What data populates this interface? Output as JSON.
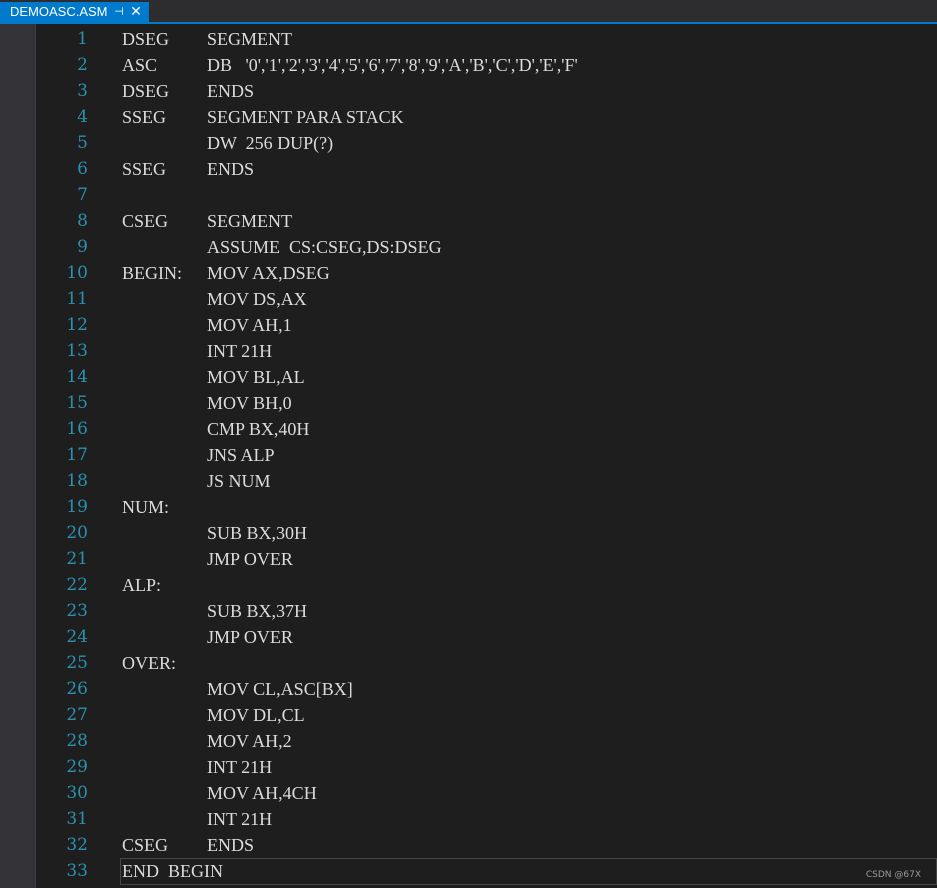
{
  "tab": {
    "filename": "DEMOASC.ASM",
    "pin_icon": "pin-icon",
    "close_icon": "close-icon"
  },
  "colors": {
    "accent": "#007acc",
    "editor_bg": "#1e1e1e",
    "line_number": "#2b91af",
    "text": "#dcdcdc"
  },
  "lines": [
    {
      "n": "1",
      "label": "DSEG",
      "op": "SEGMENT"
    },
    {
      "n": "2",
      "label": "ASC",
      "op": "DB   '0','1','2','3','4','5','6','7','8','9','A','B','C','D','E','F'"
    },
    {
      "n": "3",
      "label": "DSEG",
      "op": "ENDS"
    },
    {
      "n": "4",
      "label": "SSEG",
      "op": "SEGMENT PARA STACK"
    },
    {
      "n": "5",
      "label": "",
      "op": "DW  256 DUP(?)"
    },
    {
      "n": "6",
      "label": "SSEG",
      "op": "ENDS"
    },
    {
      "n": "7",
      "label": "",
      "op": ""
    },
    {
      "n": "8",
      "label": "CSEG",
      "op": "SEGMENT"
    },
    {
      "n": "9",
      "label": "",
      "op": "ASSUME  CS:CSEG,DS:DSEG"
    },
    {
      "n": "10",
      "label": "BEGIN:",
      "op": "MOV AX,DSEG"
    },
    {
      "n": "11",
      "label": "",
      "op": "MOV DS,AX"
    },
    {
      "n": "12",
      "label": "",
      "op": "MOV AH,1"
    },
    {
      "n": "13",
      "label": "",
      "op": "INT 21H"
    },
    {
      "n": "14",
      "label": "",
      "op": "MOV BL,AL"
    },
    {
      "n": "15",
      "label": "",
      "op": "MOV BH,0"
    },
    {
      "n": "16",
      "label": "",
      "op": "CMP BX,40H"
    },
    {
      "n": "17",
      "label": "",
      "op": "JNS ALP"
    },
    {
      "n": "18",
      "label": "",
      "op": "JS NUM"
    },
    {
      "n": "19",
      "label": "NUM:",
      "op": ""
    },
    {
      "n": "20",
      "label": "",
      "op": "SUB BX,30H"
    },
    {
      "n": "21",
      "label": "",
      "op": "JMP OVER"
    },
    {
      "n": "22",
      "label": "ALP:",
      "op": ""
    },
    {
      "n": "23",
      "label": "",
      "op": "SUB BX,37H"
    },
    {
      "n": "24",
      "label": "",
      "op": "JMP OVER"
    },
    {
      "n": "25",
      "label": "OVER:",
      "op": ""
    },
    {
      "n": "26",
      "label": "",
      "op": "MOV CL,ASC[BX]"
    },
    {
      "n": "27",
      "label": "",
      "op": "MOV DL,CL"
    },
    {
      "n": "28",
      "label": "",
      "op": "MOV AH,2"
    },
    {
      "n": "29",
      "label": "",
      "op": "INT 21H"
    },
    {
      "n": "30",
      "label": "",
      "op": "MOV AH,4CH"
    },
    {
      "n": "31",
      "label": "",
      "op": "INT 21H"
    },
    {
      "n": "32",
      "label": "CSEG",
      "op": "ENDS"
    },
    {
      "n": "33",
      "label": "END  BEGIN",
      "op": ""
    }
  ],
  "watermark": "CSDN @67X"
}
